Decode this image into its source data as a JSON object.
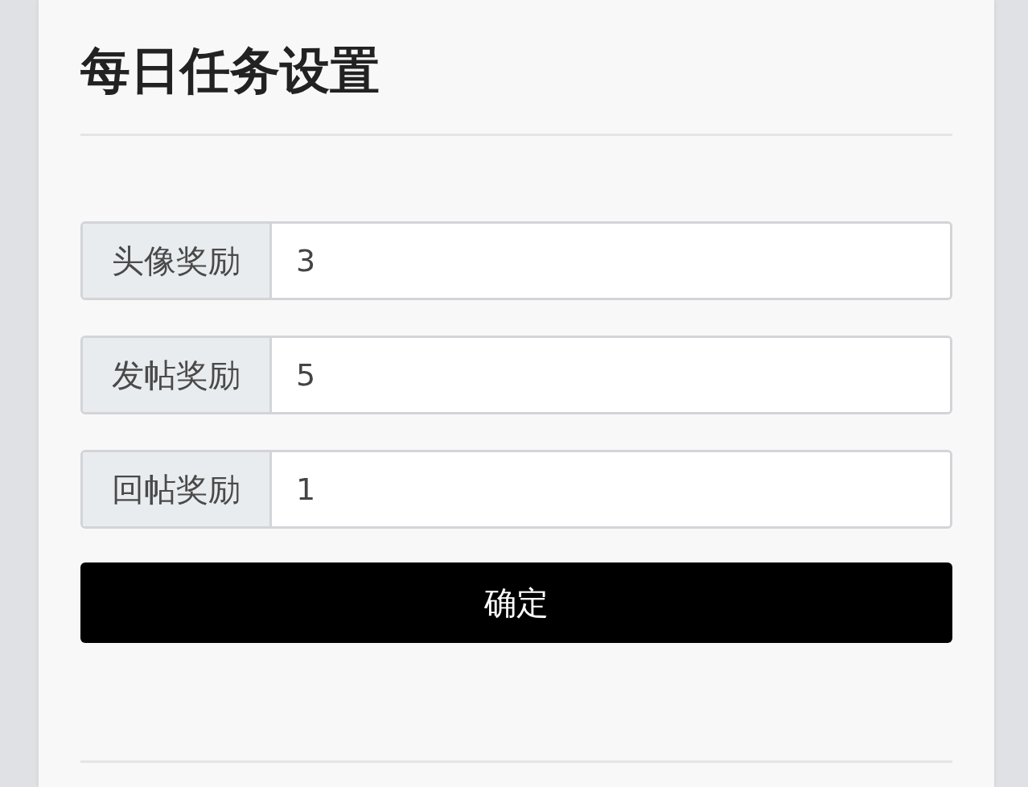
{
  "title": "每日任务设置",
  "fields": [
    {
      "label": "头像奖励",
      "value": "3"
    },
    {
      "label": "发帖奖励",
      "value": "5"
    },
    {
      "label": "回帖奖励",
      "value": "1"
    }
  ],
  "submit": "确定"
}
